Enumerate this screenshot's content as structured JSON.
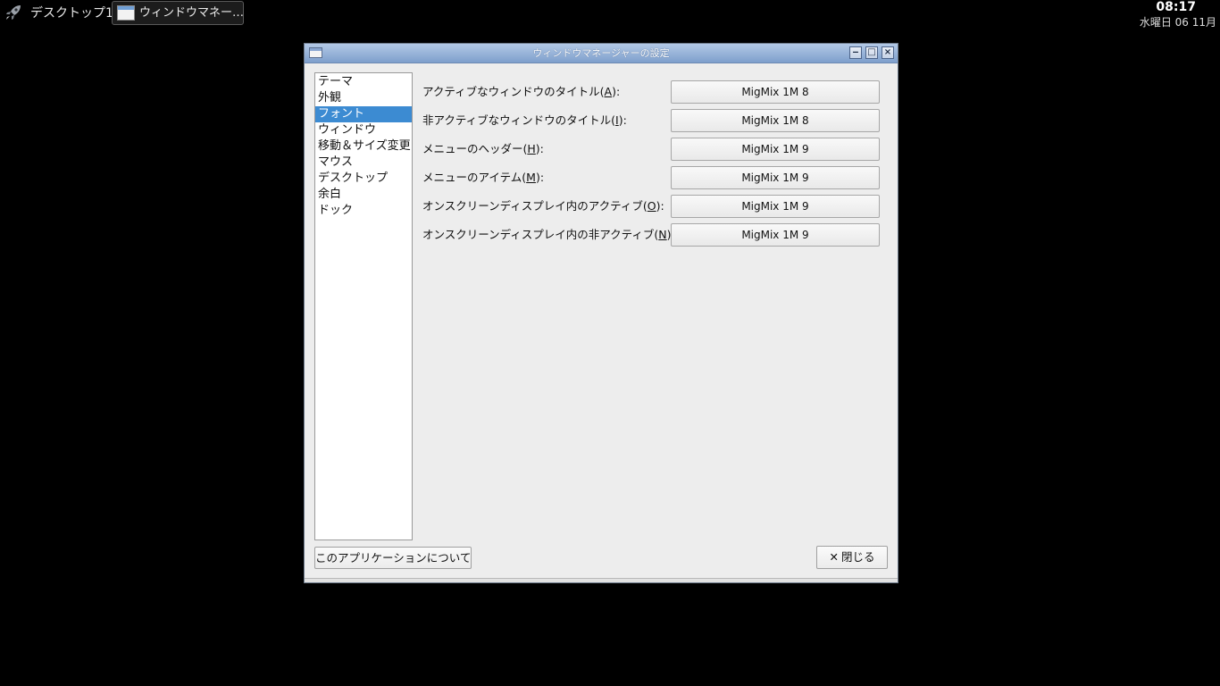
{
  "panel": {
    "launcher_icon": "rocket-icon",
    "desktop_name": "デスクトップ1",
    "task": {
      "icon": "window-icon",
      "label": "ウィンドウマネー…"
    },
    "clock": {
      "time": "08:17",
      "date": "水曜日 06 11月"
    }
  },
  "window": {
    "title": "ウィンドウマネージャーの設定",
    "icon": "window-icon",
    "controls": {
      "minimize": "minimize-icon",
      "maximize": "maximize-icon",
      "close": "close-icon"
    },
    "sidebar": {
      "items": [
        {
          "label": "テーマ"
        },
        {
          "label": "外観"
        },
        {
          "label": "フォント",
          "selected": true
        },
        {
          "label": "ウィンドウ"
        },
        {
          "label": "移動＆サイズ変更"
        },
        {
          "label": "マウス"
        },
        {
          "label": "デスクトップ"
        },
        {
          "label": "余白"
        },
        {
          "label": "ドック"
        }
      ]
    },
    "fonts": [
      {
        "label_pre": "アクティブなウィンドウのタイトル(",
        "key": "A",
        "label_post": "):",
        "value": "MigMix 1M 8"
      },
      {
        "label_pre": "非アクティブなウィンドウのタイトル(",
        "key": "I",
        "label_post": "):",
        "value": "MigMix 1M 8"
      },
      {
        "label_pre": "メニューのヘッダー(",
        "key": "H",
        "label_post": "):",
        "value": "MigMix 1M 9"
      },
      {
        "label_pre": "メニューのアイテム(",
        "key": "M",
        "label_post": "):",
        "value": "MigMix 1M 9"
      },
      {
        "label_pre": "オンスクリーンディスプレイ内のアクティブ(",
        "key": "O",
        "label_post": "):",
        "value": "MigMix 1M 9"
      },
      {
        "label_pre": "オンスクリーンディスプレイ内の非アクティブ(",
        "key": "N",
        "label_post": "):",
        "value": "MigMix 1M 9"
      }
    ],
    "about_button": "このアプリケーションについて",
    "close_button": {
      "icon": "close-icon",
      "label": "閉じる"
    }
  }
}
